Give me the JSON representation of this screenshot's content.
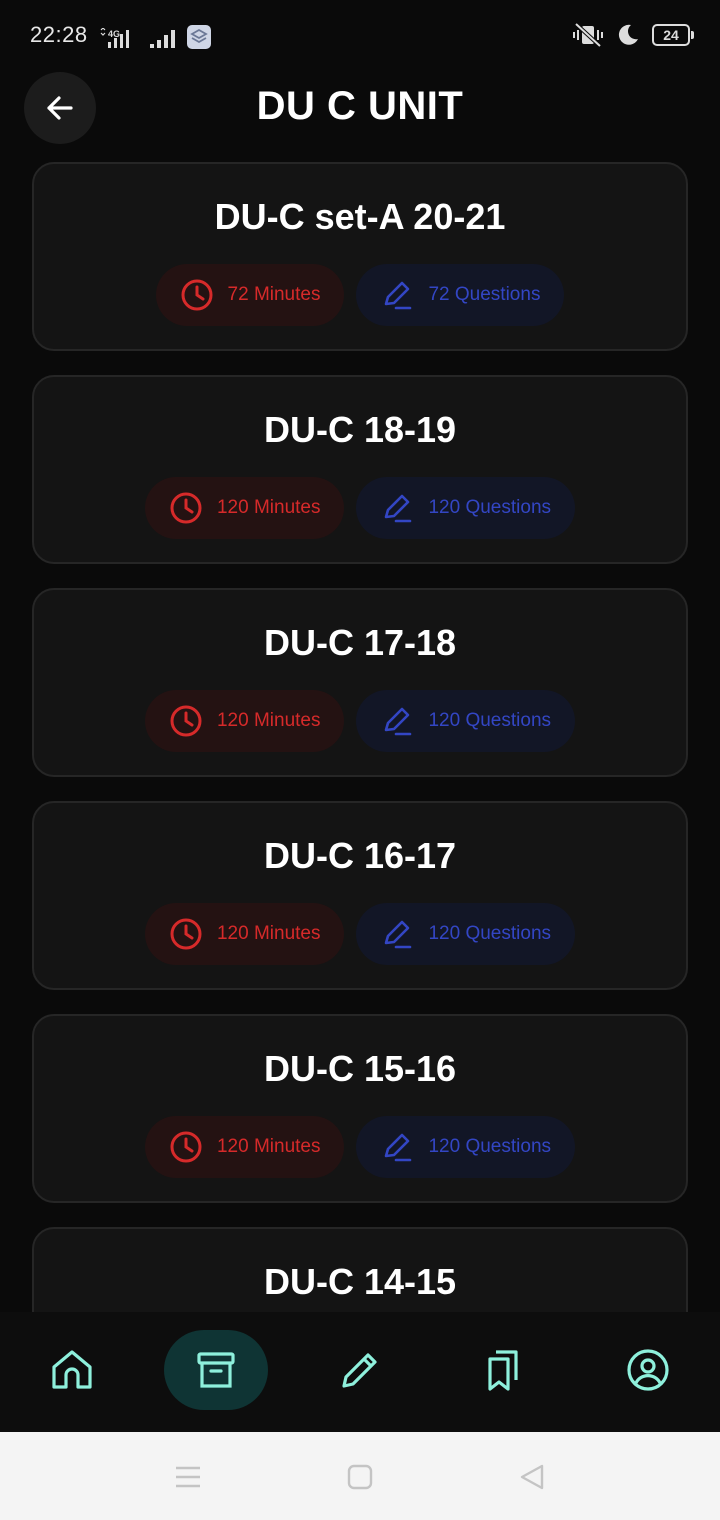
{
  "status_bar": {
    "time": "22:28",
    "network": "4G",
    "battery": "24"
  },
  "header": {
    "title": "DU C UNIT",
    "back_icon": "arrow-left-icon"
  },
  "tests": [
    {
      "title": "DU-C set-A 20-21",
      "minutes": "72 Minutes",
      "questions": "72 Questions"
    },
    {
      "title": "DU-C 18-19",
      "minutes": "120 Minutes",
      "questions": "120 Questions"
    },
    {
      "title": "DU-C 17-18",
      "minutes": "120 Minutes",
      "questions": "120 Questions"
    },
    {
      "title": "DU-C 16-17",
      "minutes": "120 Minutes",
      "questions": "120 Questions"
    },
    {
      "title": "DU-C 15-16",
      "minutes": "120 Minutes",
      "questions": "120 Questions"
    },
    {
      "title": "DU-C 14-15"
    }
  ],
  "bottom_nav": [
    "home-icon",
    "archive-icon",
    "pencil-icon",
    "bookmarks-icon",
    "user-circle-icon"
  ],
  "colors": {
    "background": "#0a0a0a",
    "card": "#141414",
    "minutes_red": "#d62a2a",
    "questions_blue": "#3346c4",
    "nav_teal": "#8ef0dc",
    "nav_active_bg": "#0f3434"
  }
}
